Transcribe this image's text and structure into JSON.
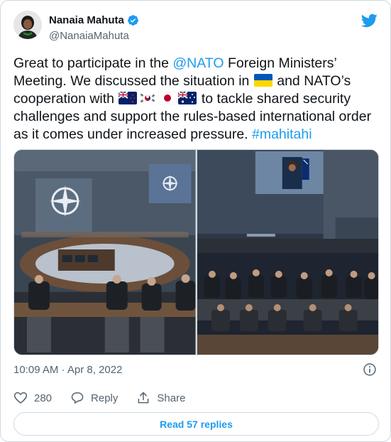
{
  "author": {
    "display_name": "Nanaia Mahuta",
    "handle": "@NanaiaMahuta",
    "verified": true
  },
  "tweet": {
    "part1": "Great to participate in the ",
    "mention": "@NATO",
    "part2": " Foreign Ministers’ Meeting. We discussed the situation in ",
    "part3": " and NATO’s cooperation with ",
    "part4": " to tackle shared security challenges and support the rules-based international order as it comes under increased pressure. ",
    "hashtag": "#mahitahi",
    "flags": [
      "ukraine-flag",
      "new-zealand-flag",
      "south-korea-flag",
      "japan-flag",
      "australia-flag"
    ]
  },
  "media": {
    "left_image": "nato-meeting-room-photo",
    "right_image": "video-conference-screen-photo"
  },
  "meta": {
    "timestamp": "10:09 AM · Apr 8, 2022"
  },
  "actions": {
    "like_count": "280",
    "reply_label": "Reply",
    "share_label": "Share"
  },
  "read_replies_label": "Read 57 replies",
  "colors": {
    "accent": "#1d9bf0",
    "text": "#0f1419",
    "secondary": "#536471",
    "border": "#cfd9de"
  }
}
